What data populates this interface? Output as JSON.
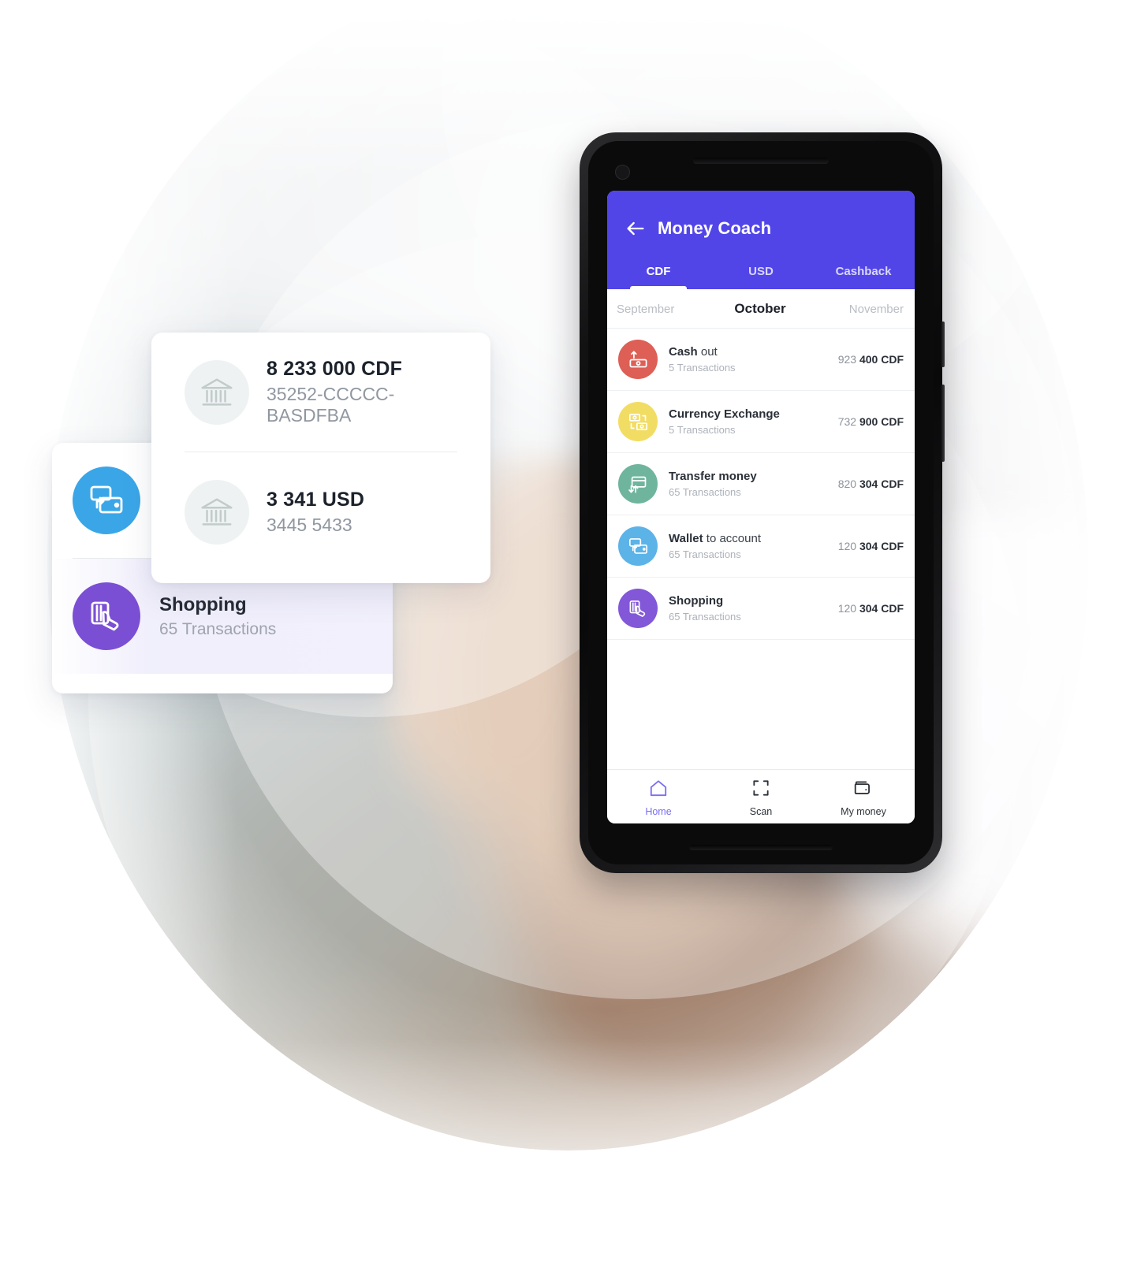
{
  "phone_app": {
    "header": {
      "back_icon": "arrow-left-icon",
      "title": "Money Coach",
      "accent_color": "#5145e8"
    },
    "tabs": [
      {
        "label": "CDF",
        "active": true
      },
      {
        "label": "USD",
        "active": false
      },
      {
        "label": "Cashback",
        "active": false
      }
    ],
    "months": [
      {
        "label": "September",
        "selected": false
      },
      {
        "label": "October",
        "selected": true
      },
      {
        "label": "November",
        "selected": false
      }
    ],
    "transactions": [
      {
        "icon": "cash-out-icon",
        "icon_color": "#dd5f56",
        "title_bold": "Cash",
        "title_rest": " out",
        "subtitle": "5 Transactions",
        "amount_lead": "923 ",
        "amount_bold": "400 CDF"
      },
      {
        "icon": "currency-exchange-icon",
        "icon_color": "#f2dd64",
        "title_bold": "Currency Exchange",
        "title_rest": "",
        "subtitle": "5 Transactions",
        "amount_lead": "732 ",
        "amount_bold": "900 CDF"
      },
      {
        "icon": "transfer-money-icon",
        "icon_color": "#6fb59e",
        "title_bold": "Transfer money",
        "title_rest": "",
        "subtitle": "65 Transactions",
        "amount_lead": "820 ",
        "amount_bold": "304 CDF"
      },
      {
        "icon": "wallet-to-account-icon",
        "icon_color": "#5cb3e8",
        "title_bold": "Wallet",
        "title_rest": " to account",
        "subtitle": "65 Transactions",
        "amount_lead": "120 ",
        "amount_bold": "304 CDF"
      },
      {
        "icon": "shopping-card-icon",
        "icon_color": "#8257d8",
        "title_bold": "Shopping",
        "title_rest": "",
        "subtitle": "65 Transactions",
        "amount_lead": "120 ",
        "amount_bold": "304 CDF"
      }
    ],
    "bottom_nav": [
      {
        "icon": "home-icon",
        "label": "Home",
        "active": true
      },
      {
        "icon": "scan-icon",
        "label": "Scan",
        "active": false
      },
      {
        "icon": "wallet-icon",
        "label": "My money",
        "active": false
      }
    ]
  },
  "accounts_card": {
    "rows": [
      {
        "icon": "bank-icon",
        "amount": "8 233 000 CDF",
        "number": "35252-CCCCC-BASDFBA"
      },
      {
        "icon": "bank-icon",
        "amount": "3 341 USD",
        "number": "3445 5433"
      }
    ]
  },
  "categories_card": {
    "rows": [
      {
        "icon": "wallet-to-account-icon",
        "icon_color": "#3aa6e8",
        "title": "",
        "subtitle": "",
        "selected": false
      },
      {
        "icon": "shopping-card-icon",
        "icon_color": "#7b4fd4",
        "title": "Shopping",
        "subtitle": "65 Transactions",
        "selected": true
      }
    ]
  }
}
